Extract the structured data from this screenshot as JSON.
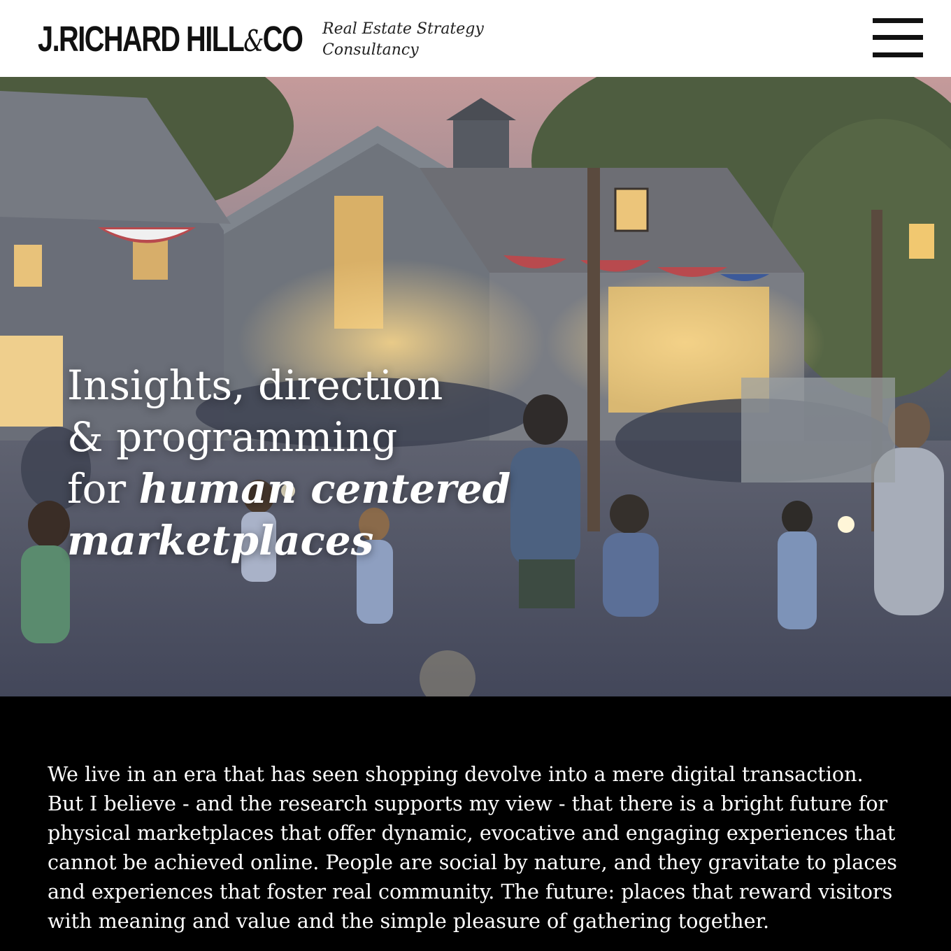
{
  "header": {
    "logo_main": "J.RICHARD HILL",
    "logo_amp": "&",
    "logo_suffix": "CO",
    "tagline_line1": "Real Estate Strategy",
    "tagline_line2": "Consultancy",
    "menu_icon": "hamburger-menu-icon"
  },
  "hero": {
    "image": "illustrated evening marketplace barn scene with crowd and string lights",
    "headline_line1": "Insights, direction",
    "headline_line2": "& programming",
    "headline_line3_plain": "for ",
    "headline_line3_emphasis": "human centered",
    "headline_line4_emphasis": "marketplaces"
  },
  "intro": {
    "paragraph": "We live in an era that has seen shopping devolve into a mere digital transaction. But I believe - and the research supports my view - that there is a bright future for physical marketplaces that offer dynamic, evocative and engaging experiences that cannot be achieved online. People are social by nature, and they gravitate to places and experiences that foster real community. The future: places that reward visitors with meaning and value and the simple pleasure of gathering together."
  },
  "colors": {
    "header_bg": "#ffffff",
    "body_bg": "#000000",
    "text_dark": "#111111",
    "text_light": "#ffffff"
  }
}
